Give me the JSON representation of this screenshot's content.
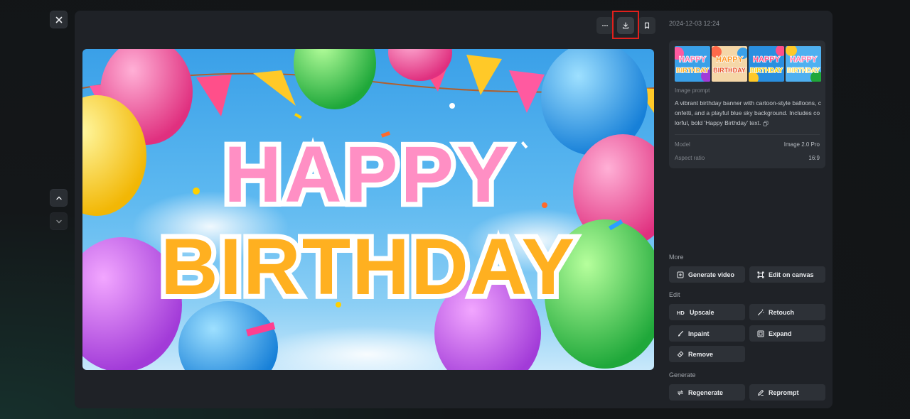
{
  "viewer": {
    "close_icon": "close-icon",
    "nav_up_icon": "chevron-up-icon",
    "nav_down_icon": "chevron-down-icon"
  },
  "toolbar": {
    "more_icon": "more-icon",
    "download_icon": "download-icon",
    "bookmark_icon": "bookmark-icon"
  },
  "image": {
    "line1": "HAPPY",
    "line2": "BIRTHDAY"
  },
  "details": {
    "timestamp": "2024-12-03 12:24",
    "thumbnails": [
      {
        "line1": "HAPPY",
        "line2": "BIRTHDAY"
      },
      {
        "line1": "HAPPY",
        "line2": "BIRTHDAY"
      },
      {
        "line1": "HAPPY",
        "line2": "BIRTHDAY"
      },
      {
        "line1": "HAPPY",
        "line2": "BIRTHDAY"
      }
    ],
    "prompt_label": "Image prompt",
    "prompt_text": "A vibrant birthday banner with cartoon-style balloons, confetti, and a playful blue sky background. Includes colorful, bold 'Happy Birthday' text.",
    "model_label": "Model",
    "model_value": "Image 2.0 Pro",
    "aspect_label": "Aspect ratio",
    "aspect_value": "16:9"
  },
  "sections": {
    "more": "More",
    "edit": "Edit",
    "generate": "Generate"
  },
  "actions": {
    "generate_video": "Generate video",
    "edit_on_canvas": "Edit on canvas",
    "upscale": "Upscale",
    "retouch": "Retouch",
    "inpaint": "Inpaint",
    "expand": "Expand",
    "remove": "Remove",
    "regenerate": "Regenerate",
    "reprompt": "Reprompt"
  },
  "colors": {
    "accent_highlight": "#e0201c",
    "panel_bg": "#1f2227"
  }
}
